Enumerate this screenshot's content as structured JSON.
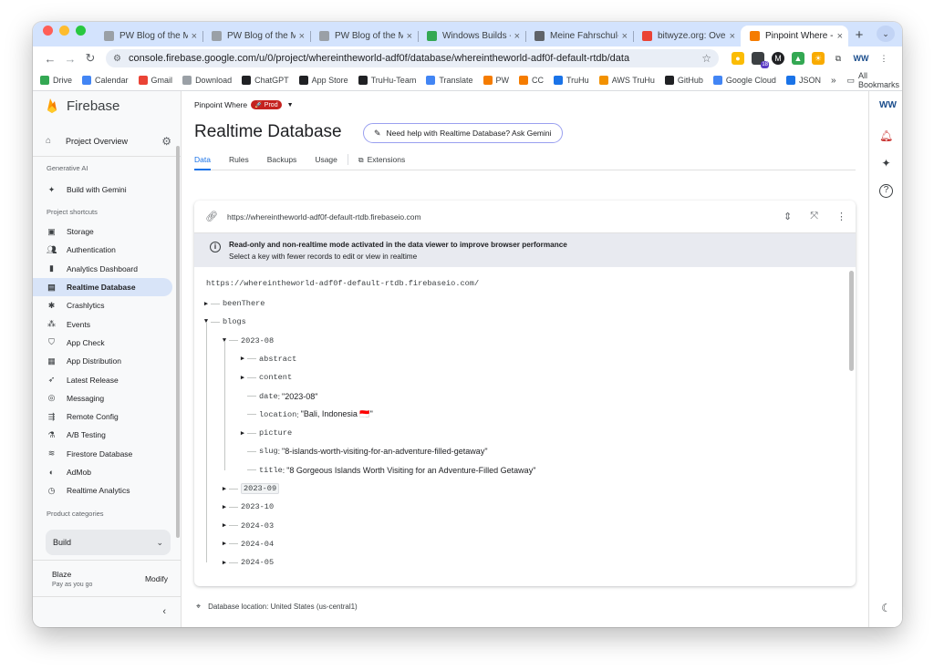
{
  "browser": {
    "tabs": [
      {
        "title": "PW Blog of the Month",
        "favicon": "doc-icon",
        "color": "#9aa0a6",
        "active": false
      },
      {
        "title": "PW Blog of the Month",
        "favicon": "doc-icon",
        "color": "#9aa0a6",
        "active": false
      },
      {
        "title": "PW Blog of the Month",
        "favicon": "doc-icon",
        "color": "#9aa0a6",
        "active": false
      },
      {
        "title": "Windows Builds - Google Drive",
        "favicon": "drive-icon",
        "color": "#34a853",
        "active": false
      },
      {
        "title": "Meine Fahrschul-App",
        "favicon": "globe-icon",
        "color": "#5f6368",
        "active": false
      },
      {
        "title": "bitwyze.org: Overview",
        "favicon": "bitwyze-icon",
        "color": "#ea4335",
        "active": false
      },
      {
        "title": "Pinpoint Where - Realtime Database",
        "favicon": "firebase-icon",
        "color": "#f57c00",
        "active": true
      }
    ],
    "url": "console.firebase.google.com/u/0/project/whereintheworld-adf0f/database/whereintheworld-adf0f-default-rtdb/data",
    "extension_badge": "18",
    "bookmarks": [
      {
        "label": "Drive",
        "icon": "drive-icon",
        "color": "#34a853"
      },
      {
        "label": "Calendar",
        "icon": "calendar-icon",
        "color": "#4285f4"
      },
      {
        "label": "Gmail",
        "icon": "gmail-icon",
        "color": "#ea4335"
      },
      {
        "label": "Download",
        "icon": "download-icon",
        "color": "#9aa0a6"
      },
      {
        "label": "ChatGPT",
        "icon": "chatgpt-icon",
        "color": "#202124"
      },
      {
        "label": "App Store",
        "icon": "apple-icon",
        "color": "#202124"
      },
      {
        "label": "TruHu-Team",
        "icon": "github-icon",
        "color": "#202124"
      },
      {
        "label": "Translate",
        "icon": "translate-icon",
        "color": "#4285f4"
      },
      {
        "label": "PW",
        "icon": "firebase-icon",
        "color": "#f57c00"
      },
      {
        "label": "CC",
        "icon": "firebase-icon",
        "color": "#f57c00"
      },
      {
        "label": "TruHu",
        "icon": "truhu-icon",
        "color": "#1a73e8"
      },
      {
        "label": "AWS TruHu",
        "icon": "aws-icon",
        "color": "#f29100"
      },
      {
        "label": "GitHub",
        "icon": "github-icon",
        "color": "#202124"
      },
      {
        "label": "Google Cloud",
        "icon": "cloud-icon",
        "color": "#4285f4"
      },
      {
        "label": "JSON",
        "icon": "json-icon",
        "color": "#1a73e8"
      }
    ],
    "more": "»",
    "all_bookmarks": "All Bookmarks"
  },
  "sidebar": {
    "brand": "Firebase",
    "project_overview": "Project Overview",
    "generative_ai_header": "Generative AI",
    "build_with_gemini": "Build with Gemini",
    "shortcuts_header": "Project shortcuts",
    "shortcuts": [
      {
        "label": "Storage",
        "icon": "storage-icon",
        "active": false
      },
      {
        "label": "Authentication",
        "icon": "people-icon",
        "active": false
      },
      {
        "label": "Analytics Dashboard",
        "icon": "bar-chart-icon",
        "active": false
      },
      {
        "label": "Realtime Database",
        "icon": "database-icon",
        "active": true
      },
      {
        "label": "Crashlytics",
        "icon": "crash-icon",
        "active": false
      },
      {
        "label": "Events",
        "icon": "events-icon",
        "active": false
      },
      {
        "label": "App Check",
        "icon": "shield-icon",
        "active": false
      },
      {
        "label": "App Distribution",
        "icon": "distribution-icon",
        "active": false
      },
      {
        "label": "Latest Release",
        "icon": "rocket-icon",
        "active": false
      },
      {
        "label": "Messaging",
        "icon": "messaging-icon",
        "active": false
      },
      {
        "label": "Remote Config",
        "icon": "remote-config-icon",
        "active": false
      },
      {
        "label": "A/B Testing",
        "icon": "flask-icon",
        "active": false
      },
      {
        "label": "Firestore Database",
        "icon": "firestore-icon",
        "active": false
      },
      {
        "label": "AdMob",
        "icon": "admob-icon",
        "active": false
      },
      {
        "label": "Realtime Analytics",
        "icon": "clock-icon",
        "active": false
      }
    ],
    "categories_header": "Product categories",
    "build_category": "Build",
    "plan_name": "Blaze",
    "plan_sub": "Pay as you go",
    "modify": "Modify",
    "collapse": "‹"
  },
  "main": {
    "project_name": "Pinpoint Where",
    "env_badge": "Prod",
    "title": "Realtime Database",
    "gemini_button": "Need help with Realtime Database? Ask Gemini",
    "tabs": [
      {
        "label": "Data",
        "active": true
      },
      {
        "label": "Rules",
        "active": false
      },
      {
        "label": "Backups",
        "active": false
      },
      {
        "label": "Usage",
        "active": false
      },
      {
        "label": "Extensions",
        "active": false
      }
    ],
    "db_url": "https://whereintheworld-adf0f-default-rtdb.firebaseio.com",
    "notice_line1": "Read-only and non-realtime mode activated in the data viewer to improve browser performance",
    "notice_line2": "Select a key with fewer records to edit or view in realtime",
    "tree_root": "https://whereintheworld-adf0f-default-rtdb.firebaseio.com/",
    "tree": [
      {
        "key": "beenThere",
        "value": null,
        "expandable": true,
        "expanded": false
      },
      {
        "key": "blogs",
        "value": null,
        "expandable": true,
        "expanded": true
      },
      {
        "key": "2023-08",
        "value": null,
        "expandable": true,
        "expanded": true
      },
      {
        "key": "abstract",
        "value": null,
        "expandable": true,
        "expanded": false
      },
      {
        "key": "content",
        "value": null,
        "expandable": true,
        "expanded": false
      },
      {
        "key": "date",
        "value": "\"2023-08\"",
        "expandable": false
      },
      {
        "key": "location",
        "value": "\"Bali, Indonesia 🇮🇩\"",
        "expandable": false
      },
      {
        "key": "picture",
        "value": null,
        "expandable": true,
        "expanded": false
      },
      {
        "key": "slug",
        "value": "\"8-islands-worth-visiting-for-an-adventure-filled-getaway\"",
        "expandable": false
      },
      {
        "key": "title",
        "value": "\"8 Gorgeous Islands Worth Visiting for an Adventure-Filled Getaway\"",
        "expandable": false
      },
      {
        "key": "2023-09",
        "value": null,
        "expandable": true,
        "expanded": false,
        "highlighted": true
      },
      {
        "key": "2023-10",
        "value": null,
        "expandable": true,
        "expanded": false
      },
      {
        "key": "2024-03",
        "value": null,
        "expandable": true,
        "expanded": false
      },
      {
        "key": "2024-04",
        "value": null,
        "expandable": true,
        "expanded": false
      },
      {
        "key": "2024-05",
        "value": null,
        "expandable": true,
        "expanded": false
      }
    ],
    "db_location": "Database location: United States (us-central1)"
  }
}
